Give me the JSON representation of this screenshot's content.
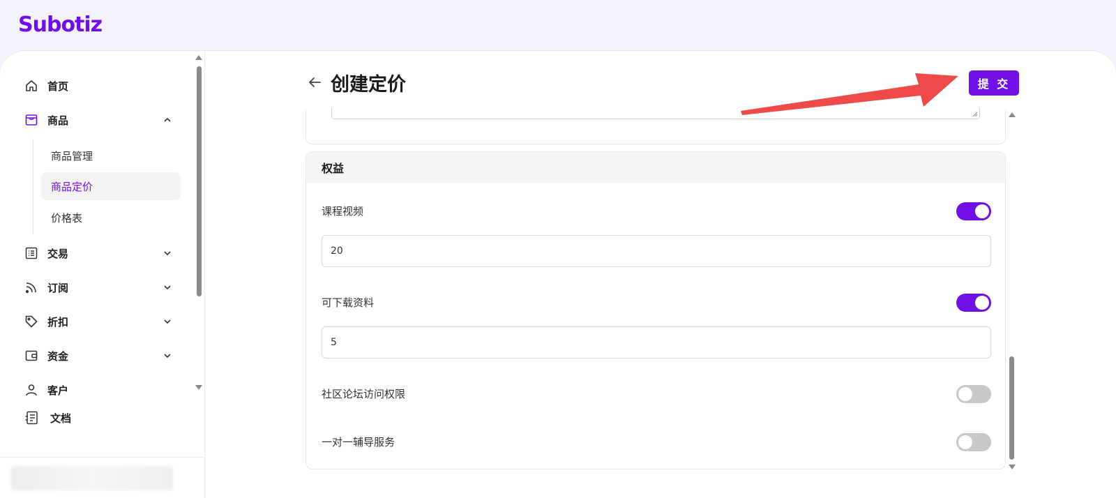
{
  "brand": {
    "name": "Subotiz",
    "color": "#6f10e6"
  },
  "sidebar": {
    "items": [
      {
        "label": "首页",
        "icon": "home-icon"
      },
      {
        "label": "商品",
        "icon": "store-icon",
        "expanded": true
      },
      {
        "label": "交易",
        "icon": "list-icon"
      },
      {
        "label": "订阅",
        "icon": "rss-icon"
      },
      {
        "label": "折扣",
        "icon": "tag-icon"
      },
      {
        "label": "资金",
        "icon": "wallet-icon"
      },
      {
        "label": "客户",
        "icon": "user-icon"
      },
      {
        "label": "文档",
        "icon": "document-icon"
      }
    ],
    "sub_items": [
      {
        "label": "商品管理"
      },
      {
        "label": "商品定价",
        "active": true
      },
      {
        "label": "价格表"
      }
    ]
  },
  "header": {
    "title": "创建定价",
    "submit_label": "提 交"
  },
  "benefits": {
    "title": "权益",
    "rows": [
      {
        "label": "课程视频",
        "enabled": true,
        "value": "20"
      },
      {
        "label": "可下载资料",
        "enabled": true,
        "value": "5"
      },
      {
        "label": "社区论坛访问权限",
        "enabled": false
      },
      {
        "label": "一对一辅导服务",
        "enabled": false
      }
    ]
  },
  "colors": {
    "accent": "#6f10e6",
    "annotation_arrow": "#ef4a4a",
    "toggle_off": "#c8c8c8"
  }
}
